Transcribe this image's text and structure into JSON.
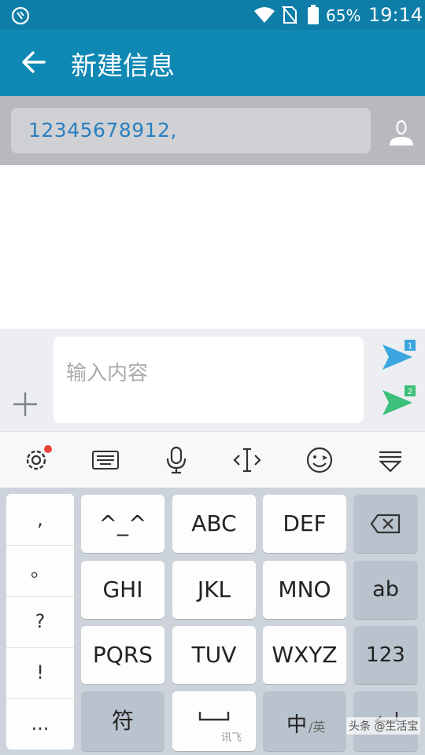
{
  "status_bar": {
    "battery_percent": "65%",
    "time": "19:14"
  },
  "header": {
    "title": "新建信息"
  },
  "recipient": {
    "value": "12345678912,"
  },
  "compose": {
    "placeholder": "输入内容",
    "send_sim1_badge": "1",
    "send_sim2_badge": "2"
  },
  "keyboard": {
    "punctuation": [
      ",",
      "。",
      "?",
      "!",
      "..."
    ],
    "rows": [
      [
        "^_^",
        "ABC",
        "DEF"
      ],
      [
        "GHI",
        "JKL",
        "MNO"
      ],
      [
        "PQRS",
        "TUV",
        "WXYZ"
      ]
    ],
    "side_keys": [
      "ab",
      "123"
    ],
    "bottom": {
      "symbol": "符",
      "space_brand": "讯飞",
      "lang_main": "中",
      "lang_alt": "/英"
    }
  },
  "watermark": "头条 @生活宝",
  "colors": {
    "header": "#1088b4",
    "accent_send_1": "#3ba6e0",
    "accent_send_2": "#3cc07a"
  }
}
